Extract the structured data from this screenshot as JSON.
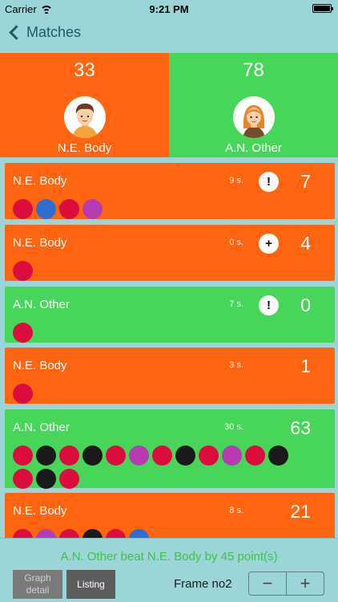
{
  "status": {
    "carrier": "Carrier",
    "time": "9:21 PM"
  },
  "nav": {
    "back_label": "Matches"
  },
  "players": [
    {
      "name": "N.E. Body",
      "total": "33",
      "color": "#ff6511"
    },
    {
      "name": "A.N. Other",
      "total": "78",
      "color": "#47d65a"
    }
  ],
  "rows": [
    {
      "player": "N.E. Body",
      "time": "9 s.",
      "badge": "!",
      "score": "7",
      "balls": [
        "red",
        "blue",
        "red",
        "pink"
      ]
    },
    {
      "player": "N.E. Body",
      "time": "0 s.",
      "badge": "+",
      "score": "4",
      "balls": [
        "red"
      ]
    },
    {
      "player": "A.N. Other",
      "time": "7 s.",
      "badge": "!",
      "score": "0",
      "balls": [
        "red"
      ]
    },
    {
      "player": "N.E. Body",
      "time": "3 s.",
      "badge": "",
      "score": "1",
      "balls": [
        "red"
      ]
    },
    {
      "player": "A.N. Other",
      "time": "30 s.",
      "badge": "",
      "score": "63",
      "balls": [
        "red",
        "black",
        "red",
        "black",
        "red",
        "pink",
        "red",
        "black",
        "red",
        "pink",
        "red",
        "black",
        "red",
        "black",
        "red"
      ]
    },
    {
      "player": "N.E. Body",
      "time": "8 s.",
      "badge": "",
      "score": "21",
      "balls": [
        "red",
        "pink",
        "red",
        "black",
        "red",
        "blue"
      ]
    }
  ],
  "footer": {
    "summary": "A.N. Other beat N.E. Body by 45 point(s)",
    "graph_line1": "Graph",
    "graph_line2": "detail",
    "listing_label": "Listing",
    "frame_label": "Frame no2",
    "minus": "−",
    "plus": "+"
  },
  "colors": {
    "ball_red": "#dc0c3d",
    "ball_blue": "#2e6dd1",
    "ball_pink": "#b63cb1",
    "ball_black": "#1a1a1a"
  }
}
